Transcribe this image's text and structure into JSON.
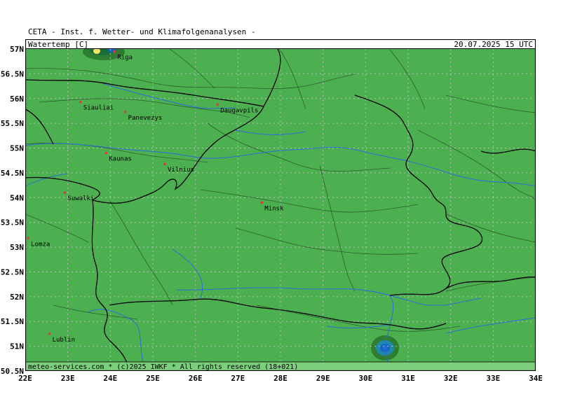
{
  "header": {
    "title": "CETA - Inst. f. Wetter- und Klimafolgenanalysen -",
    "parameter": "Watertemp [C]",
    "datetime": "20.07.2025 15 UTC"
  },
  "footer": {
    "credit": "meteo-services.com * (c)2025 IWKF * All rights reserved (18+021)"
  },
  "axes": {
    "lon_labels": [
      "22E",
      "23E",
      "24E",
      "25E",
      "26E",
      "27E",
      "28E",
      "29E",
      "30E",
      "31E",
      "32E",
      "33E",
      "34E"
    ],
    "lat_labels": [
      "57N",
      "56.5N",
      "56N",
      "55.5N",
      "55N",
      "54.5N",
      "54N",
      "53.5N",
      "53N",
      "52.5N",
      "52N",
      "51.5N",
      "51N",
      "50.5N"
    ]
  },
  "cities": [
    {
      "name": "Riga",
      "lon": 24.1,
      "lat": 56.95
    },
    {
      "name": "Siauliai",
      "lon": 23.3,
      "lat": 55.93
    },
    {
      "name": "Panevezys",
      "lon": 24.35,
      "lat": 55.73
    },
    {
      "name": "Daugavpils",
      "lon": 26.52,
      "lat": 55.88
    },
    {
      "name": "Kaunas",
      "lon": 23.9,
      "lat": 54.9
    },
    {
      "name": "Vilnius",
      "lon": 25.28,
      "lat": 54.68
    },
    {
      "name": "Suwalki",
      "lon": 22.93,
      "lat": 54.1
    },
    {
      "name": "Minsk",
      "lon": 27.56,
      "lat": 53.9
    },
    {
      "name": "Lomza",
      "lon": 22.07,
      "lat": 53.18
    },
    {
      "name": "Lublin",
      "lon": 22.57,
      "lat": 51.25
    }
  ],
  "colors": {
    "land": "#4caf50",
    "sea_dark": "#1b6e3c",
    "water_blue": "#1e6fe0",
    "grid": "#bdbdbd",
    "river": "#2b6fd6",
    "border": "#000000",
    "region": "#2e5f2e",
    "city_marker": "#e53935"
  }
}
